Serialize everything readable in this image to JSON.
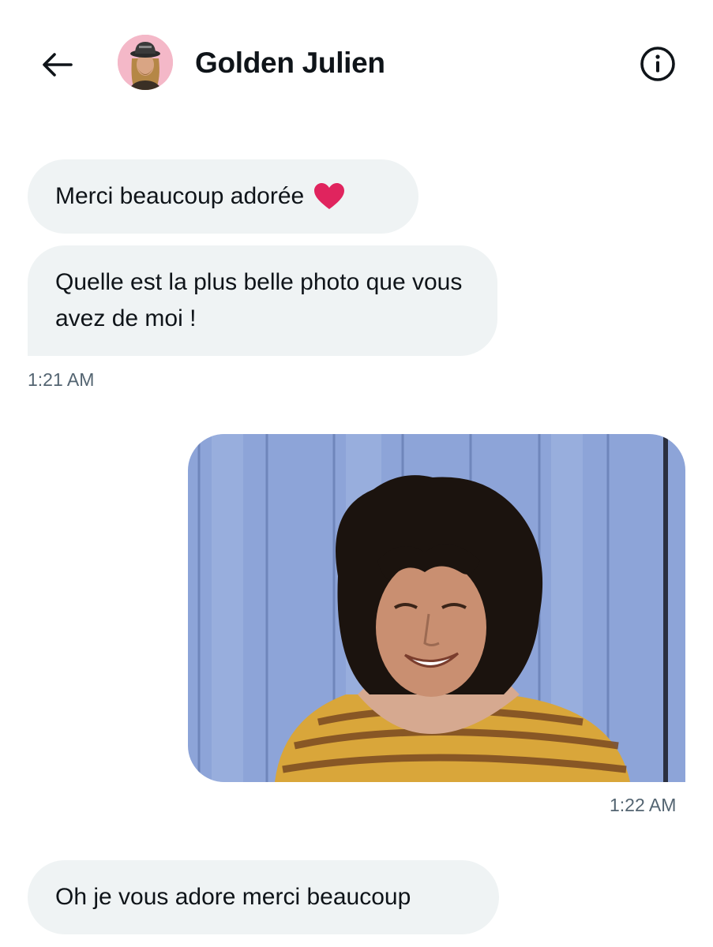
{
  "header": {
    "back_icon": "arrow-left-icon",
    "contact_name": "Golden Julien",
    "info_icon": "info-circle-icon"
  },
  "messages": [
    {
      "direction": "received",
      "text": "Merci beaucoup adorée",
      "emoji": "red-heart"
    },
    {
      "direction": "received",
      "text": "Quelle est la plus belle photo que vous avez de moi !"
    },
    {
      "timestamp": "1:21 AM"
    },
    {
      "direction": "sent",
      "type": "image"
    },
    {
      "timestamp": "1:22 AM"
    },
    {
      "direction": "received",
      "text": "Oh je vous adore merci beaucoup"
    }
  ],
  "colors": {
    "bubble_received": "#eff3f4",
    "text_primary": "#0f1419",
    "text_secondary": "#536471",
    "heart": "#e0245e",
    "avatar_bg": "#f4b8c8",
    "photo_wall": "#8da4d8"
  }
}
